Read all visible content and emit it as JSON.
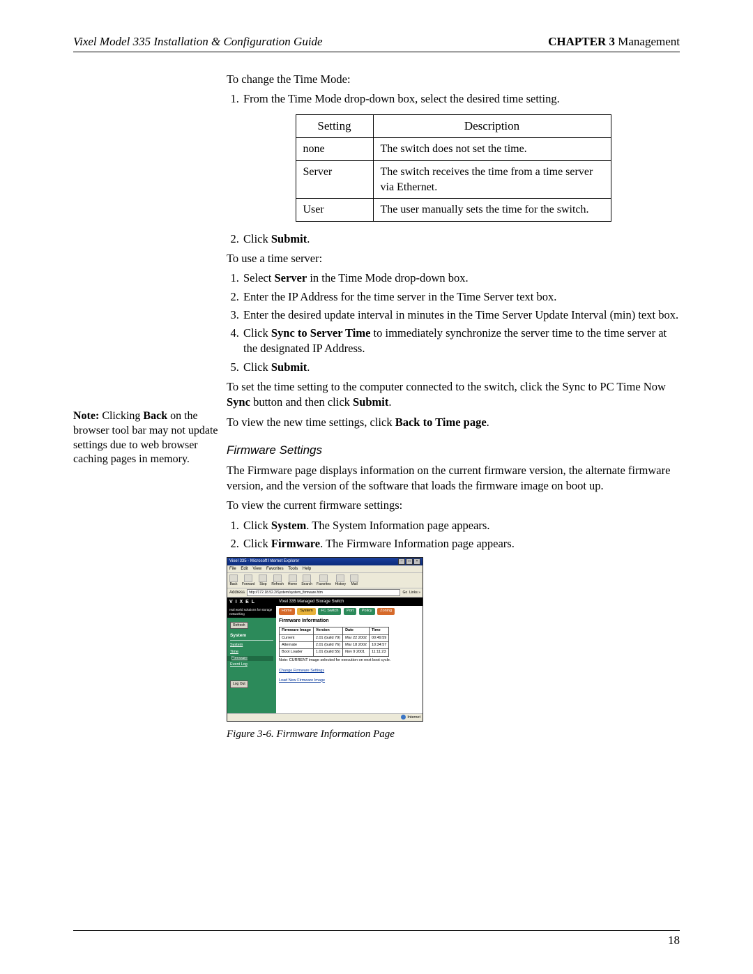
{
  "header": {
    "left": "Vixel Model 335 Installation & Configuration Guide",
    "chapter": "CHAPTER 3",
    "section": "Management"
  },
  "margin_note": {
    "prefix": "Note:",
    "text": " Clicking ",
    "bold1": "Back",
    "text2": " on the browser tool bar may not update settings due to web browser caching pages in memory."
  },
  "intro": "To change the Time Mode:",
  "step1": "From the Time Mode drop-down box, select the desired time setting.",
  "table_head": {
    "c1": "Setting",
    "c2": "Description"
  },
  "table_rows": [
    {
      "c1": "none",
      "c2": "The switch does not set the time."
    },
    {
      "c1": "Server",
      "c2": "The switch receives the time from a time server via Ethernet."
    },
    {
      "c1": "User",
      "c2": "The user manually sets the time for the switch."
    }
  ],
  "step2_pre": "Click ",
  "step2_bold": "Submit",
  "step2_post": ".",
  "use_server": "To use a time server:",
  "server_steps": {
    "s1_pre": "Select ",
    "s1_bold": "Server",
    "s1_post": " in the Time Mode drop-down box.",
    "s2": "Enter the IP Address for the time server in the Time Server text box.",
    "s3": "Enter the desired update interval in minutes in the Time Server Update Interval (min) text box.",
    "s4_pre": "Click ",
    "s4_bold": "Sync to Server Time",
    "s4_post": " to immediately synchronize the server time to the time server at the designated IP Address.",
    "s5_pre": "Click ",
    "s5_bold": "Submit",
    "s5_post": "."
  },
  "pc_sync_pre": "To set the time setting to the computer connected to the switch, click the Sync to PC Time Now ",
  "pc_sync_bold1": "Sync",
  "pc_sync_mid": " button and then click ",
  "pc_sync_bold2": "Submit",
  "pc_sync_post": ".",
  "view_time_pre": "To view the new time settings, click ",
  "view_time_bold": "Back to Time page",
  "view_time_post": ".",
  "fw_heading": "Firmware Settings",
  "fw_para": "The Firmware page displays information on the current firmware version, the alternate firmware version, and the version of the software that loads the firmware image on boot up.",
  "fw_view": "To view the current firmware settings:",
  "fw_steps": {
    "s1_pre": "Click ",
    "s1_bold": "System",
    "s1_post": ". The System Information page appears.",
    "s2_pre": "Click ",
    "s2_bold": "Firmware",
    "s2_post": ". The Firmware Information page appears."
  },
  "figure_caption": "Figure 3-6. Firmware Information Page",
  "page_number": "18",
  "screenshot": {
    "title": "Vixel 335 - Microsoft Internet Explorer",
    "menu": [
      "File",
      "Edit",
      "View",
      "Favorites",
      "Tools",
      "Help"
    ],
    "toolbar": [
      "Back",
      "Forward",
      "Stop",
      "Refresh",
      "Home",
      "Search",
      "Favorites",
      "History",
      "Mail"
    ],
    "address_label": "Address",
    "address": "http://172.18.52.2/System/system_firmware.htm",
    "go": "Go",
    "links": "Links »",
    "logo": "V I X E L",
    "tagline": "real world solutions for storage networking",
    "product": "Vixel 335 Managed Storage Switch",
    "tabs": [
      "Home",
      "System",
      "FC Switch",
      "Port",
      "Policy",
      "Zoning"
    ],
    "refresh_btn": "Refresh",
    "side_header": "System",
    "side_links": [
      "System",
      "Time",
      "Firmware",
      "Event Log"
    ],
    "logout": "Log Out",
    "section_title": "Firmware Information",
    "fw_table_head": [
      "Firmware Image",
      "Version",
      "Date",
      "Time"
    ],
    "fw_rows": [
      [
        "Current",
        "2.01 (build 79)",
        "Mar 22 2002",
        "00:49:59"
      ],
      [
        "Alternate",
        "2.01 (build 76)",
        "Mar 18 2002",
        "10:34:57"
      ],
      [
        "Boot Loader",
        "1.01 (build 55)",
        "Nov 9 2001",
        "11:11:23"
      ]
    ],
    "fw_note": "Note: CURRENT image selected for execution on next boot cycle.",
    "link1": "Change Firmware Settings",
    "link2": "Load New Firmware Image",
    "status_left": "",
    "status_right": "Internet"
  }
}
